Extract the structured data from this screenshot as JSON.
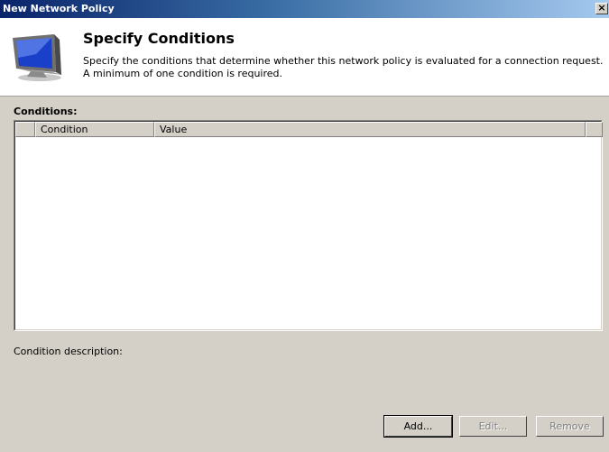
{
  "window": {
    "title": "New Network Policy",
    "close_glyph": "×"
  },
  "header": {
    "icon": "monitor-icon",
    "title": "Specify Conditions",
    "description": "Specify the conditions that determine whether this network policy is evaluated for a connection request. A minimum of one condition is required."
  },
  "conditions": {
    "label": "Conditions:",
    "columns": [
      "Condition",
      "Value"
    ],
    "rows": []
  },
  "description": {
    "label": "Condition description:"
  },
  "buttons": {
    "add": "Add...",
    "edit": "Edit...",
    "remove": "Remove"
  }
}
